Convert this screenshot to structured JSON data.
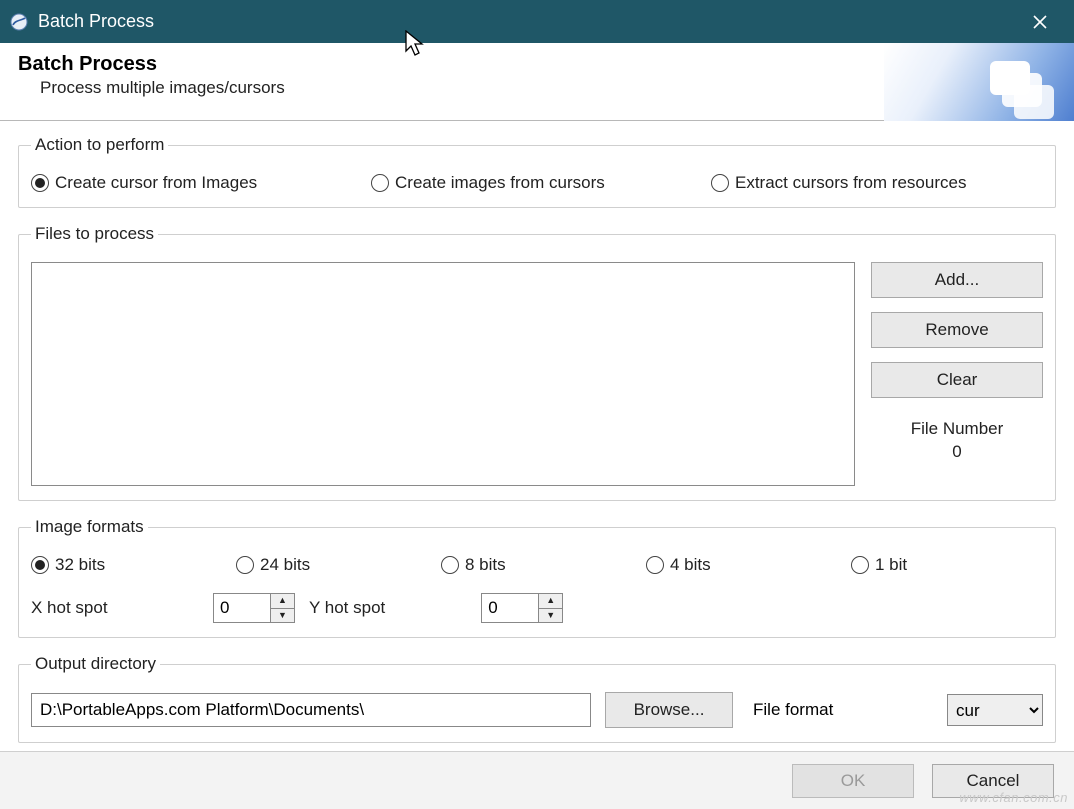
{
  "window": {
    "title": "Batch Process"
  },
  "header": {
    "title": "Batch Process",
    "subtitle": "Process multiple images/cursors"
  },
  "action": {
    "legend": "Action to perform",
    "options": [
      "Create cursor from Images",
      "Create images from cursors",
      "Extract cursors from resources"
    ],
    "selected_index": 0
  },
  "files": {
    "legend": "Files to process",
    "add_label": "Add...",
    "remove_label": "Remove",
    "clear_label": "Clear",
    "count_label": "File Number",
    "count_value": "0"
  },
  "formats": {
    "legend": "Image formats",
    "options": [
      "32 bits",
      "24 bits",
      "8 bits",
      "4 bits",
      "1 bit"
    ],
    "selected_index": 0,
    "x_label": "X hot spot",
    "y_label": "Y hot spot",
    "x_value": "0",
    "y_value": "0"
  },
  "output": {
    "legend": "Output directory",
    "path": "D:\\PortableApps.com Platform\\Documents\\",
    "browse_label": "Browse...",
    "format_label": "File format",
    "format_value": "cur"
  },
  "footer": {
    "ok_label": "OK",
    "cancel_label": "Cancel"
  },
  "watermark": "www.cfan.com.cn"
}
